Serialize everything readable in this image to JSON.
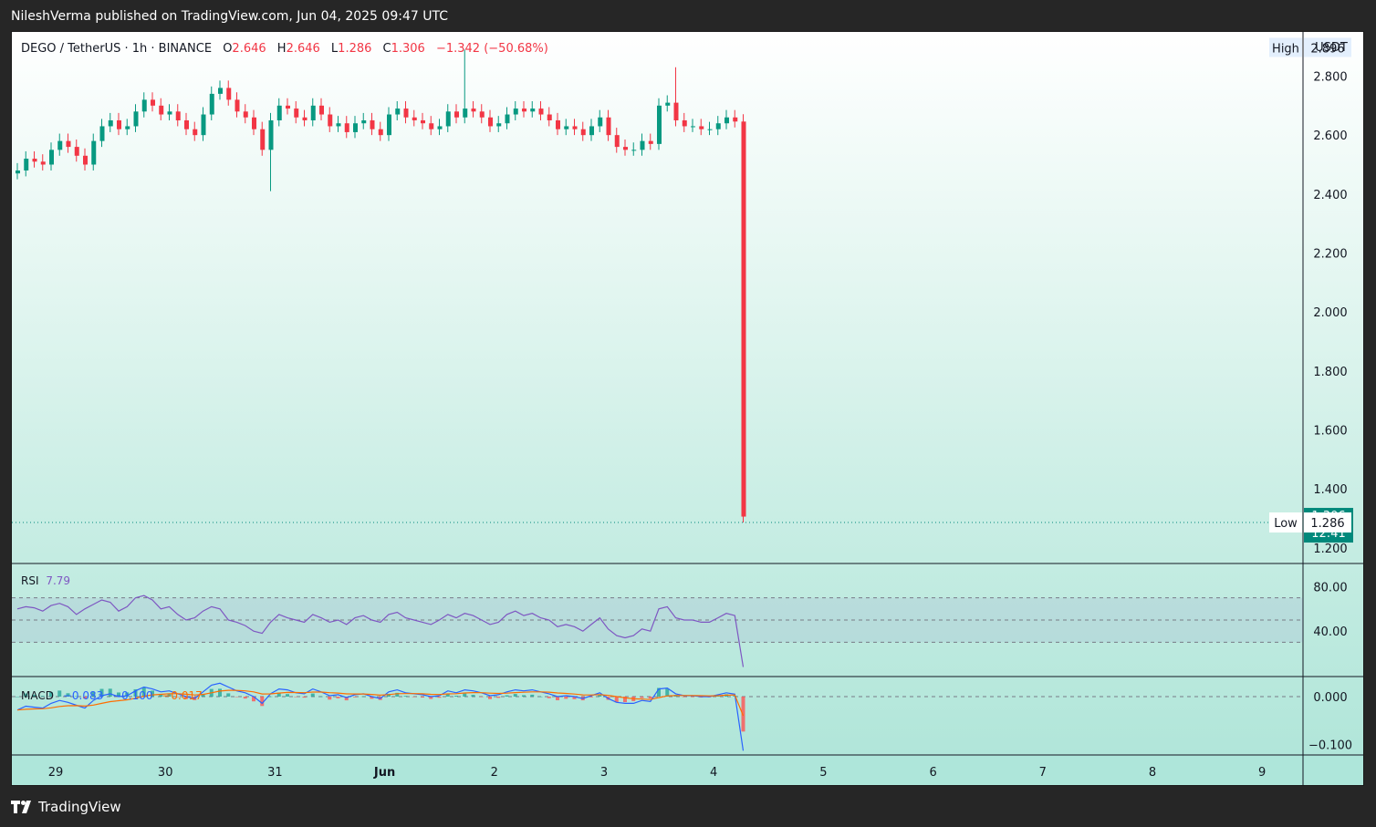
{
  "header": {
    "published_text": "NileshVerma published on TradingView.com, Jun 04, 2025 09:47 UTC"
  },
  "legend": {
    "symbol": "DEGO / TetherUS · 1h · BINANCE",
    "open_label": "O",
    "open": "2.646",
    "high_label": "H",
    "high": "2.646",
    "low_label": "L",
    "low": "1.286",
    "close_label": "C",
    "close": "1.306",
    "change": "−1.342 (−50.68%)"
  },
  "price_axis": {
    "unit": "USDT",
    "ticks": [
      "2.800",
      "2.600",
      "2.400",
      "2.200",
      "2.000",
      "1.800",
      "1.600",
      "1.400",
      "1.200"
    ],
    "high_tag": "High",
    "high_value": "2.896",
    "low_tag": "Low",
    "low_value": "1.286",
    "last_price": "1.306",
    "countdown": "12:41"
  },
  "rsi": {
    "label": "RSI",
    "value": "7.79",
    "ticks": [
      "80.00",
      "40.00"
    ]
  },
  "macd": {
    "label": "MACD",
    "macd": "−0.083",
    "signal": "−0.100",
    "hist": "−0.017",
    "ticks": [
      "0.000",
      "−0.100"
    ]
  },
  "time_axis": {
    "labels": [
      "29",
      "30",
      "31",
      "Jun",
      "2",
      "3",
      "4",
      "5",
      "6",
      "7",
      "8",
      "9"
    ]
  },
  "colors": {
    "up": "#089981",
    "down": "#f23645",
    "rsi": "#7e57c2",
    "macd": "#2962ff",
    "signal": "#ff6d00",
    "axis_tag": "#00897b"
  },
  "brand": {
    "name": "TradingView"
  },
  "chart_data": {
    "type": "candlestick",
    "interval": "1h",
    "y_range": [
      1.15,
      2.95
    ],
    "x_labels": [
      "29",
      "30",
      "31",
      "Jun",
      "2",
      "3",
      "4",
      "5",
      "6",
      "7",
      "8",
      "9"
    ],
    "price_line": [
      2.48,
      2.52,
      2.51,
      2.5,
      2.55,
      2.58,
      2.56,
      2.53,
      2.5,
      2.58,
      2.63,
      2.65,
      2.62,
      2.63,
      2.68,
      2.72,
      2.7,
      2.67,
      2.68,
      2.65,
      2.62,
      2.6,
      2.67,
      2.74,
      2.76,
      2.72,
      2.68,
      2.66,
      2.62,
      2.55,
      2.65,
      2.7,
      2.69,
      2.66,
      2.65,
      2.7,
      2.67,
      2.63,
      2.64,
      2.61,
      2.64,
      2.65,
      2.62,
      2.6,
      2.67,
      2.69,
      2.66,
      2.65,
      2.64,
      2.62,
      2.63,
      2.68,
      2.66,
      2.69,
      2.68,
      2.66,
      2.63,
      2.64,
      2.67,
      2.69,
      2.68,
      2.69,
      2.67,
      2.65,
      2.62,
      2.63,
      2.62,
      2.6,
      2.63,
      2.66,
      2.6,
      2.56,
      2.55,
      2.55,
      2.58,
      2.57,
      2.7,
      2.71,
      2.65,
      2.63,
      2.63,
      2.62,
      2.62,
      2.64,
      2.66,
      2.646,
      1.306
    ],
    "high": 2.896,
    "low": 1.286,
    "last_close": 1.306,
    "rsi": {
      "range": [
        0,
        100
      ],
      "bands": [
        70,
        50,
        30
      ],
      "values": [
        60,
        62,
        61,
        58,
        63,
        65,
        62,
        55,
        60,
        64,
        68,
        66,
        58,
        62,
        70,
        72,
        68,
        60,
        62,
        55,
        50,
        52,
        58,
        62,
        60,
        50,
        48,
        45,
        40,
        38,
        48,
        55,
        52,
        50,
        48,
        55,
        52,
        48,
        50,
        46,
        52,
        54,
        50,
        48,
        55,
        57,
        52,
        50,
        48,
        46,
        50,
        55,
        52,
        56,
        54,
        50,
        46,
        48,
        55,
        58,
        54,
        56,
        52,
        50,
        44,
        46,
        44,
        40,
        46,
        52,
        42,
        36,
        34,
        36,
        42,
        40,
        60,
        62,
        52,
        50,
        50,
        48,
        48,
        52,
        56,
        54,
        7.79
      ]
    },
    "macd": {
      "range": [
        -0.12,
        0.04
      ],
      "macd_last": -0.083,
      "signal_last": -0.1,
      "hist_last": -0.017
    }
  }
}
